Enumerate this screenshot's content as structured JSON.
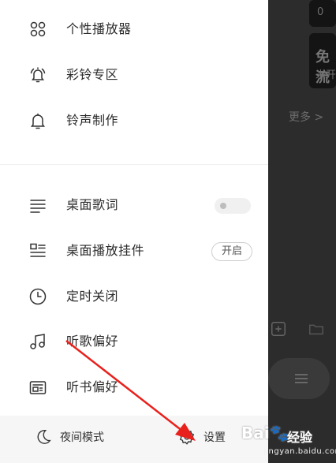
{
  "drawer": {
    "items": [
      {
        "label": "个性播放器",
        "icon": "player-skin-icon"
      },
      {
        "label": "彩铃专区",
        "icon": "ringing-bell-icon"
      },
      {
        "label": "铃声制作",
        "icon": "bell-icon"
      },
      {
        "label": "桌面歌词",
        "icon": "lyrics-lines-icon",
        "control": "toggle",
        "toggle_on": false
      },
      {
        "label": "桌面播放挂件",
        "icon": "widget-list-icon",
        "control": "pill",
        "pill_label": "开启"
      },
      {
        "label": "定时关闭",
        "icon": "clock-icon"
      },
      {
        "label": "听歌偏好",
        "icon": "music-note-icon"
      },
      {
        "label": "听书偏好",
        "icon": "radio-book-icon"
      }
    ]
  },
  "bottom_bar": {
    "night_mode_label": "夜间模式",
    "settings_label": "设置"
  },
  "background": {
    "top_number": "0",
    "card_title": "免流",
    "card_sub": "未开",
    "more_label": "更多 >"
  },
  "watermark": {
    "text": "经验",
    "url": "jingyan.baidu.com"
  },
  "colors": {
    "arrow": "#e8211c",
    "drawer_bg": "#ffffff",
    "dim_bg": "#2c2c2c"
  }
}
